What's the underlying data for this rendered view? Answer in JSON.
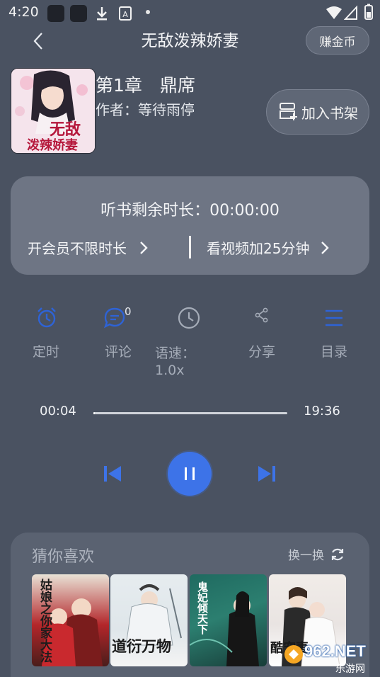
{
  "status_bar": {
    "time": "4:20"
  },
  "header": {
    "title": "无敌泼辣娇妻",
    "earn_button": "赚金币",
    "back_icon": "chevron-left-icon"
  },
  "book": {
    "cover_title_1": "无敌",
    "cover_title_2": "泼辣娇妻",
    "chapter": "第1章　鼎席",
    "author": "作者：等待雨停",
    "shelf_button": "加入书架"
  },
  "timer": {
    "remaining": "听书剩余时长：00:00:00",
    "vip_link": "开会员不限时长",
    "video_link": "看视频加25分钟"
  },
  "functions": [
    {
      "label": "定时",
      "icon": "alarm-clock-icon"
    },
    {
      "label": "评论",
      "icon": "comment-icon",
      "count": "0"
    },
    {
      "label": "语速：",
      "label2": "1.0x",
      "icon": "clock-icon"
    },
    {
      "label": "分享",
      "icon": "share-icon"
    },
    {
      "label": "目录",
      "icon": "list-icon"
    }
  ],
  "player": {
    "current_time": "00:04",
    "total_time": "19:36",
    "progress": 0.003,
    "accent": "#3d73e8"
  },
  "recommend": {
    "title": "猜你喜欢",
    "refresh": "换一换",
    "books": [
      {
        "title": "姑娘之你家大法"
      },
      {
        "title": "道衍万物"
      },
      {
        "title": "鬼妃倾天下"
      },
      {
        "title": "酷宠妻"
      }
    ]
  },
  "watermark": {
    "text1": "962.NET",
    "text2": "乐游网"
  }
}
